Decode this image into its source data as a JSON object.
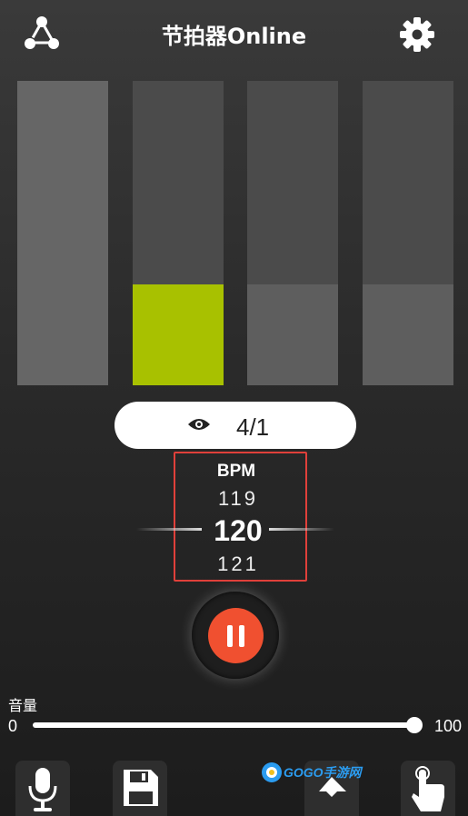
{
  "header": {
    "title": "节拍器Online",
    "share_icon": "share-icon",
    "settings_icon": "gear-icon"
  },
  "beats": [
    {
      "index": 1,
      "type": "accent",
      "active": false
    },
    {
      "index": 2,
      "type": "normal",
      "active": true
    },
    {
      "index": 3,
      "type": "normal",
      "active": false
    },
    {
      "index": 4,
      "type": "normal",
      "active": false
    }
  ],
  "time_signature": {
    "value": "4/1",
    "icon": "eye-icon"
  },
  "bpm": {
    "label": "BPM",
    "previous": "119",
    "current": "120",
    "next": "121"
  },
  "playback": {
    "state": "playing",
    "icon": "pause-icon"
  },
  "volume": {
    "label": "音量",
    "min": "0",
    "max": "100",
    "value": 100
  },
  "toolbar": {
    "items": [
      "microphone-icon",
      "save-icon",
      "tap-icon"
    ]
  },
  "watermark": {
    "text": "GOGO手游网"
  },
  "colors": {
    "active_beat": "#a8c100",
    "play_button": "#f05030",
    "bpm_highlight": "#e0403a"
  }
}
